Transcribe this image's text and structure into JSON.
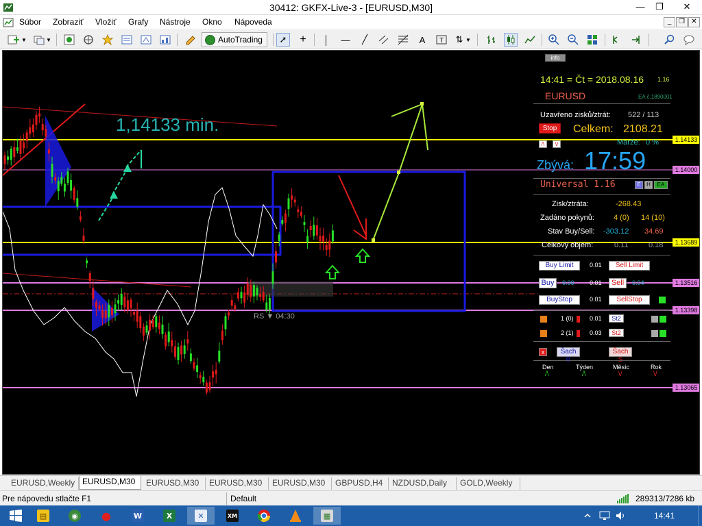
{
  "window": {
    "title": "30412: GKFX-Live-3 - [EURUSD,M30]"
  },
  "menu": {
    "items": [
      "Súbor",
      "Zobraziť",
      "Vložiť",
      "Grafy",
      "Nástroje",
      "Okno",
      "Nápoveda"
    ]
  },
  "toolbar": {
    "autotrading_label": "AutoTrading",
    "icons": [
      "new-chart-icon",
      "profiles-icon",
      "market-watch-icon",
      "navigator-icon",
      "favorites-icon",
      "data-window-icon",
      "terminal-icon",
      "strategy-tester-icon",
      "metaeditor-icon",
      "cursor-icon",
      "crosshair-icon",
      "vertical-line-icon",
      "horizontal-line-icon",
      "trendline-icon",
      "equidistant-channel-icon",
      "fibonacci-icon",
      "text-icon",
      "text-label-icon",
      "arrows-icon",
      "bar-chart-icon",
      "candlesticks-icon",
      "line-chart-icon",
      "zoom-in-icon",
      "zoom-out-icon",
      "tile-windows-icon",
      "chart-shift-icon",
      "autoscroll-icon",
      "indicators-icon",
      "periods-icon",
      "search-icon",
      "chat-icon"
    ]
  },
  "chart": {
    "annotation_min": "1,14133 min.",
    "rs_label": "RS ▼ 04:30",
    "price_tags": [
      {
        "price": "1.14133",
        "color": "#ffff00"
      },
      {
        "price": "1.14000",
        "color": "#e07ae0"
      },
      {
        "price": "1.13689",
        "color": "#ffff00"
      },
      {
        "price": "1.13516",
        "color": "#e07ae0"
      },
      {
        "price": "1.13398",
        "color": "#e07ae0"
      },
      {
        "price": "1.13065",
        "color": "#e07ae0"
      }
    ]
  },
  "panel": {
    "info_button": "info",
    "datetime": "14:41 = Čt = 2018.08.16",
    "datetime_suffix": "1.16",
    "symbol": "EURUSD",
    "ea_label": "EA č.1890001",
    "closed_label": "Uzavřeno zisků/ztrát:",
    "closed_value": "522 / 113",
    "stop_button": "Stop",
    "total_label": "Celkem:",
    "total_value": "2108.21",
    "margin_label": "Marže:",
    "margin_value": "0 %",
    "remaining_label": "Zbývá:",
    "remaining_time": "17:59",
    "universal_label": "Universal 1.16",
    "universal_badges": [
      "E",
      "H",
      "EA"
    ],
    "pl_label": "Zisk/ztráta:",
    "pl_value": "-268.43",
    "orders_label": "Zadáno pokynů:",
    "orders_buy": "4 (0)",
    "orders_sell": "14 (10)",
    "state_label": "Stav Buy/Sell:",
    "state_buy": "-303.12",
    "state_sell": "34.69",
    "volume_label": "Celkový objem:",
    "volume_buy": "0.11",
    "volume_sell": "0.18",
    "buy_limit_button": "Buy Limit",
    "buy_limit_lot": "0.01",
    "sell_limit_button": "Sell Limit",
    "buy_button": "Buy",
    "buy_price": "0.00",
    "buy_lot": "0.01",
    "sell_button": "Sell",
    "sell_price": "0.04",
    "buy_stop_button": "BuyStop",
    "buy_stop_lot": "0.01",
    "sell_stop_button": "SellStop",
    "row1_label": "1 (0)",
    "row1_lot": "0.01",
    "row1_button": "St2",
    "row2_label": "2 (1)",
    "row2_lot": "0.03",
    "row2_button": "St2",
    "close_x": "x",
    "sach_b": "Šach B",
    "sach_s": "Šach S",
    "periods": [
      {
        "label": "Den",
        "arrow": "/\\",
        "color": "#27d627"
      },
      {
        "label": "Týden",
        "arrow": "/\\",
        "color": "#27d627"
      },
      {
        "label": "Měsíc",
        "arrow": "\\/",
        "color": "#e02020"
      },
      {
        "label": "Rok",
        "arrow": "\\/",
        "color": "#e02020"
      }
    ]
  },
  "tabs": [
    "EURUSD,Weekly",
    "EURUSD,M30",
    "EURUSD,M30",
    "EURUSD,M30",
    "EURUSD,M30",
    "GBPUSD,H4",
    "NZDUSD,Daily",
    "GOLD,Weekly"
  ],
  "active_tab": 1,
  "status": {
    "help": "Pre nápovedu stlačte F1",
    "profile": "Default",
    "traffic": "289313/7286 kb"
  },
  "taskbar": {
    "apps": [
      "start",
      "file-explorer",
      "greenshot",
      "teamviewer",
      "word",
      "excel",
      "x-app",
      "xm-terminal",
      "chrome",
      "vlc",
      "metatrader"
    ],
    "time": "14:41"
  }
}
